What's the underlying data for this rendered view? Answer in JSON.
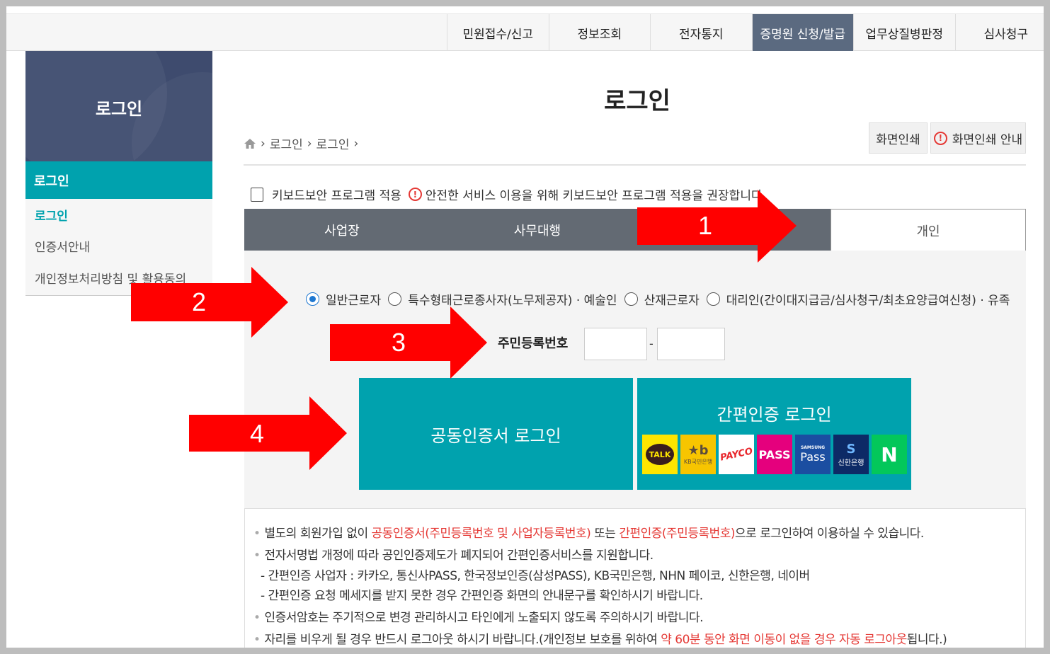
{
  "topnav": {
    "items": [
      "민원접수/신고",
      "정보조회",
      "전자통지",
      "증명원 신청/발급",
      "업무상질병판정",
      "심사청구"
    ],
    "active": "증명원 신청/발급"
  },
  "sidebar": {
    "title": "로그인",
    "menu_label": "로그인",
    "items": [
      "로그인",
      "인증서안내",
      "개인정보처리방침 및 활용동의"
    ]
  },
  "main": {
    "title": "로그인",
    "breadcrumb": [
      "로그인",
      "로그인"
    ],
    "print_label": "화면인쇄",
    "print_guide_label": "화면인쇄 안내"
  },
  "keyboard": {
    "checkbox_label": "키보드보안 프로그램 적용",
    "notice": "안전한 서비스 이용을 위해 키보드보안 프로그램 적용을 권장합니다."
  },
  "tabs": [
    "사업장",
    "사무대행",
    "개인"
  ],
  "user_types": [
    "일반근로자",
    "특수형태근로종사자(노무제공자) · 예술인",
    "산재근로자",
    "대리인(간이대지급금/심사청구/최초요양급여신청) · 유족"
  ],
  "ssn": {
    "label": "주민등록번호",
    "dash": "-"
  },
  "cert_login": "공동인증서 로그인",
  "simple_login": {
    "label": "간편인증 로그인",
    "providers": [
      {
        "name": "TALK",
        "icon": "kakao-talk-icon",
        "bg": "#fee500",
        "fg": "#3a1d1d"
      },
      {
        "name": "KB국민은행",
        "icon": "kb-bank-icon",
        "bg": "#f7c500",
        "fg": "#5a4b3c"
      },
      {
        "name": "PAYCO",
        "icon": "payco-icon",
        "bg": "#ffffff",
        "fg": "#e8242a"
      },
      {
        "name": "PASS",
        "icon": "pass-icon",
        "bg": "#e5007d",
        "fg": "#ffffff"
      },
      {
        "name": "Pass",
        "icon": "samsung-pass-icon",
        "bg": "#1b4ea1",
        "fg": "#ffffff"
      },
      {
        "name": "신한은행",
        "icon": "shinhan-bank-icon",
        "bg": "#0d2a66",
        "fg": "#ffffff"
      },
      {
        "name": "N",
        "icon": "naver-icon",
        "bg": "#03c75a",
        "fg": "#ffffff"
      }
    ]
  },
  "notices": {
    "line1_a": "별도의 회원가입 없이 ",
    "line1_b": "공동인증서(주민등록번호 및 사업자등록번호)",
    "line1_c": " 또는 ",
    "line1_d": "간편인증(주민등록번호)",
    "line1_e": "으로 로그인하여 이용하실 수 있습니다.",
    "line2": "전자서명법 개정에 따라 공인인증제도가 폐지되어 간편인증서비스를 지원합니다.",
    "line3": "- 간편인증 사업자 : 카카오, 통신사PASS, 한국정보인증(삼성PASS), KB국민은행, NHN 페이코, 신한은행, 네이버",
    "line4": "- 간편인증 요청 메세지를 받지 못한 경우 간편인증 화면의 안내문구를 확인하시기 바랍니다.",
    "line5": "인증서암호는 주기적으로 변경 관리하시고 타인에게 노출되지 않도록 주의하시기 바랍니다.",
    "line6_a": "자리를 비우게 될 경우 반드시 로그아웃 하시기 바랍니다.(개인정보 보호를 위하여 ",
    "line6_b": "약 60분 동안 화면 이동이 없을 경우 자동 로그아웃",
    "line6_c": "됩니다.)"
  },
  "arrows": [
    "1",
    "2",
    "3",
    "4"
  ],
  "colors": {
    "accent": "#00a2ae",
    "nav_active": "#5b6a80",
    "arrow": "#ff0000",
    "warning": "#e53935"
  }
}
